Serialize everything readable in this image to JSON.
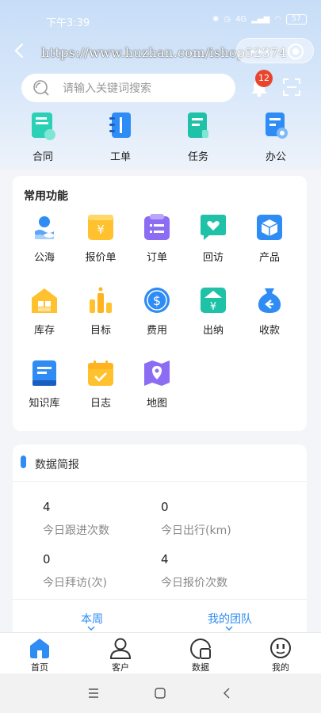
{
  "status_bar": {
    "time": "下午3:39",
    "signal_label": "4G",
    "battery": "57"
  },
  "watermark": "https://www.huzhan.com/ishop52374",
  "search": {
    "placeholder": "请输入关键词搜索"
  },
  "notifications": {
    "count": "12"
  },
  "top_shortcuts": [
    {
      "label": "合同",
      "icon": "contract-icon"
    },
    {
      "label": "工单",
      "icon": "work-order-icon"
    },
    {
      "label": "任务",
      "icon": "task-icon"
    },
    {
      "label": "办公",
      "icon": "office-icon"
    }
  ],
  "common_functions": {
    "title": "常用功能",
    "items": [
      {
        "label": "公海",
        "icon": "public-sea-icon"
      },
      {
        "label": "报价单",
        "icon": "quote-icon"
      },
      {
        "label": "订单",
        "icon": "order-icon"
      },
      {
        "label": "回访",
        "icon": "revisit-icon"
      },
      {
        "label": "产品",
        "icon": "product-icon"
      },
      {
        "label": "库存",
        "icon": "inventory-icon"
      },
      {
        "label": "目标",
        "icon": "target-icon"
      },
      {
        "label": "费用",
        "icon": "expense-icon"
      },
      {
        "label": "出纳",
        "icon": "cashier-icon"
      },
      {
        "label": "收款",
        "icon": "collection-icon"
      },
      {
        "label": "知识库",
        "icon": "knowledge-base-icon"
      },
      {
        "label": "日志",
        "icon": "log-icon"
      },
      {
        "label": "地图",
        "icon": "map-icon"
      }
    ]
  },
  "data_brief": {
    "title": "数据简报",
    "stats": [
      {
        "value": "4",
        "label": "今日跟进次数"
      },
      {
        "value": "0",
        "label": "今日出行(km)"
      },
      {
        "value": "0",
        "label": "今日拜访(次)"
      },
      {
        "value": "4",
        "label": "今日报价次数"
      }
    ],
    "filters": [
      "本周",
      "我的团队"
    ]
  },
  "bottom_nav": [
    {
      "label": "首页",
      "icon": "home-icon",
      "active": true
    },
    {
      "label": "客户",
      "icon": "customer-icon",
      "active": false
    },
    {
      "label": "数据",
      "icon": "data-icon",
      "active": false
    },
    {
      "label": "我的",
      "icon": "profile-icon",
      "active": false
    }
  ],
  "colors": {
    "accent": "#2f8cf4",
    "badge": "#e8452e",
    "hero_top": "#c7ddf7"
  }
}
